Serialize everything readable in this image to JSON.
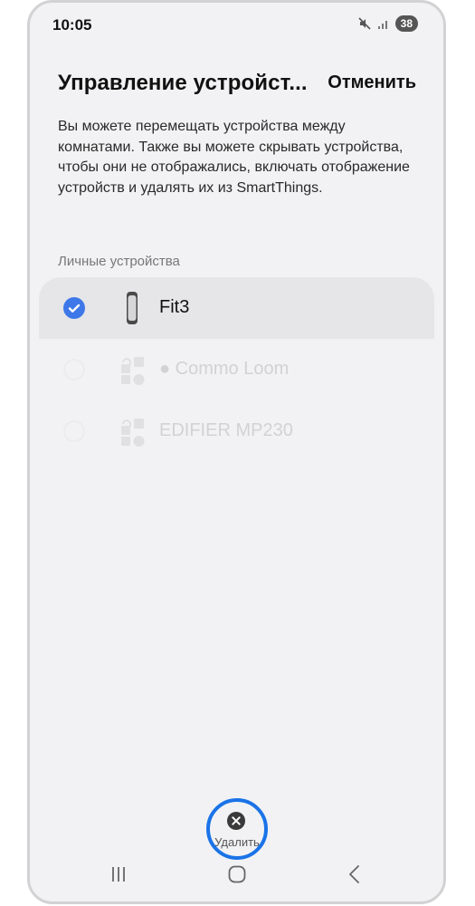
{
  "status_bar": {
    "time": "10:05",
    "battery_level": "38",
    "icons": [
      "mute-icon",
      "signal-icon"
    ]
  },
  "header": {
    "title": "Управление устройст...",
    "cancel_label": "Отменить"
  },
  "description": "Вы можете перемещать устройства между комнатами. Также вы можете скрывать устройства, чтобы они не отображались, включать отображение устройств и удалять их из SmartThings.",
  "section": {
    "title": "Личные устройства",
    "devices": [
      {
        "label": "Fit3",
        "icon": "fitness-band-icon",
        "checked": true,
        "enabled": true
      },
      {
        "label": "● Commo Loom",
        "icon": "device-shapes-icon",
        "checked": false,
        "enabled": false
      },
      {
        "label": "EDIFIER MP230",
        "icon": "device-shapes-icon",
        "checked": false,
        "enabled": false
      }
    ]
  },
  "bottom_action": {
    "delete_label": "Удалить",
    "icon": "close-circle-icon"
  },
  "nav_bar": {
    "icons": [
      "recent-apps-icon",
      "home-icon",
      "back-icon"
    ]
  },
  "colors": {
    "accent": "#3e78e8",
    "highlight_ring": "#1a73e8",
    "background": "#f2f2f4",
    "selected_row": "#e6e6e8"
  }
}
